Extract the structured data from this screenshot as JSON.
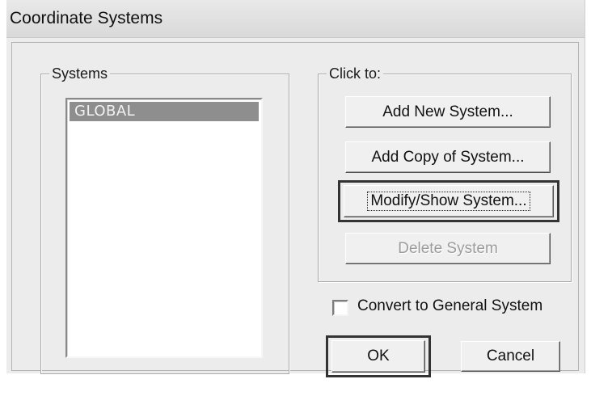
{
  "window": {
    "title": "Coordinate Systems"
  },
  "systems_group": {
    "label": "Systems",
    "items": [
      "GLOBAL"
    ],
    "selected": "GLOBAL"
  },
  "actions_group": {
    "label": "Click to:",
    "add_new": "Add New System...",
    "add_copy": "Add Copy of System...",
    "modify_show": "Modify/Show System...",
    "delete": "Delete System"
  },
  "convert_checkbox": {
    "label": "Convert to General System",
    "checked": false
  },
  "footer": {
    "ok": "OK",
    "cancel": "Cancel"
  }
}
